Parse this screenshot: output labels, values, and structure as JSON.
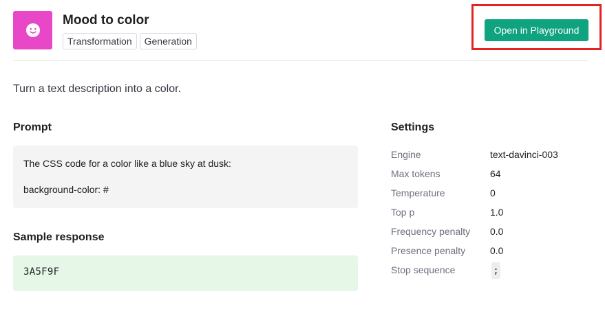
{
  "header": {
    "icon": "smiley-face-icon",
    "icon_color": "#e848c8",
    "title": "Mood to color",
    "tags": [
      "Transformation",
      "Generation"
    ],
    "playground_button_label": "Open in Playground",
    "accent_color": "#10a37f",
    "highlight_color": "#e52222"
  },
  "description": "Turn a text description into a color.",
  "prompt": {
    "heading": "Prompt",
    "lines": [
      "The CSS code for a color like a blue sky at dusk:",
      "background-color: #"
    ]
  },
  "sample_response": {
    "heading": "Sample response",
    "text": "3A5F9F",
    "background_color": "#e6f7e8"
  },
  "settings": {
    "heading": "Settings",
    "rows": [
      {
        "label": "Engine",
        "value": "text-davinci-003"
      },
      {
        "label": "Max tokens",
        "value": "64"
      },
      {
        "label": "Temperature",
        "value": "0"
      },
      {
        "label": "Top p",
        "value": "1.0"
      },
      {
        "label": "Frequency penalty",
        "value": "0.0"
      },
      {
        "label": "Presence penalty",
        "value": "0.0"
      },
      {
        "label": "Stop sequence",
        "value": ";"
      }
    ]
  }
}
